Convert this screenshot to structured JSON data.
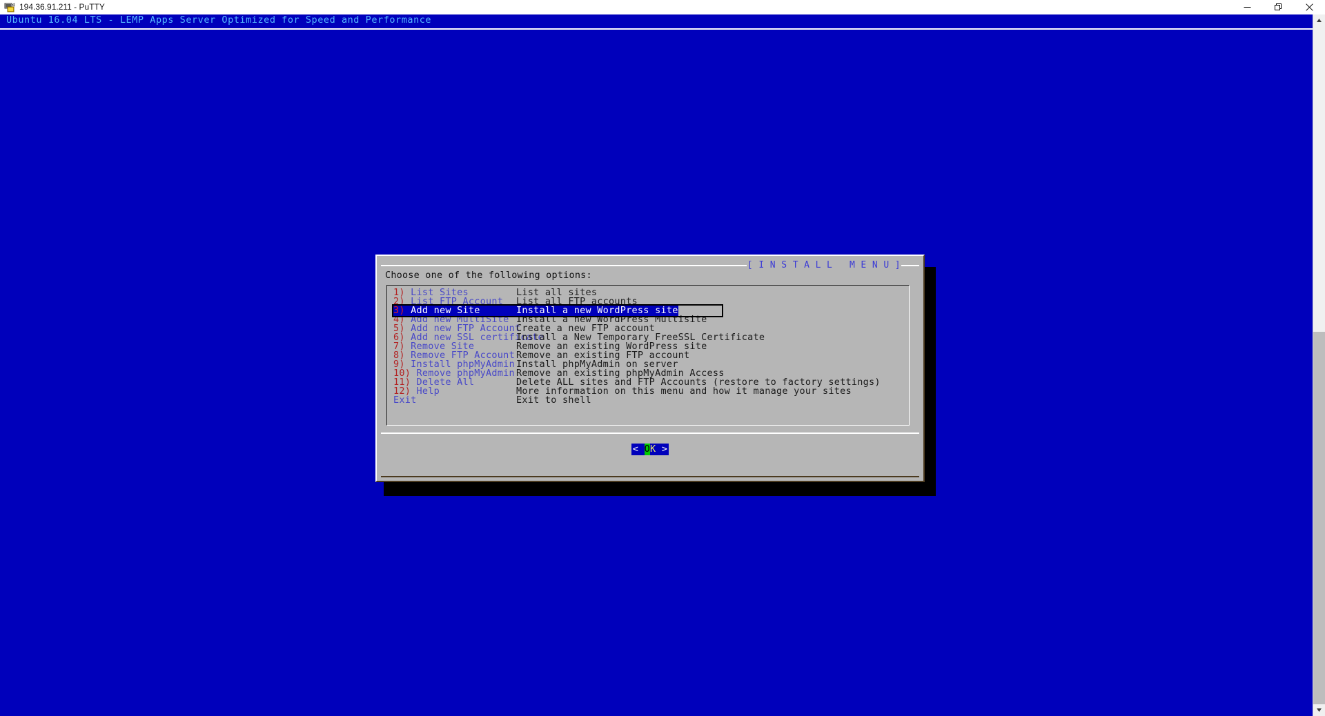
{
  "window": {
    "title": "194.36.91.211 - PuTTY",
    "icon": "putty-icon",
    "controls": {
      "minimize_label": "Minimize",
      "maximize_label": "Maximize",
      "close_label": "Close"
    }
  },
  "terminal": {
    "banner": "Ubuntu 16.04 LTS - LEMP Apps Server Optimized for Speed and Performance",
    "background_color": "#0000bb",
    "banner_color": "#54b8ff"
  },
  "scrollbar": {
    "up_arrow": "⌃",
    "down_arrow": "⌄"
  },
  "dialog": {
    "title": "[ I N S T A L L   M E N U ]",
    "prompt": "Choose one of the following options:",
    "background_color": "#b6b6b6",
    "selected_index": 2,
    "items": [
      {
        "num": "1)",
        "name": "List Sites",
        "desc": "List all sites"
      },
      {
        "num": "2)",
        "name": "List FTP Account",
        "desc": "List all FTP accounts"
      },
      {
        "num": "3)",
        "name": "Add new Site",
        "desc": "Install a new WordPress site"
      },
      {
        "num": "4)",
        "name": "Add new MultiSite",
        "desc": "Install a new WordPress Multisite"
      },
      {
        "num": "5)",
        "name": "Add new FTP Account",
        "desc": "Create a new FTP account"
      },
      {
        "num": "6)",
        "name": "Add new SSL certificate",
        "desc": "Install a New Temporary FreeSSL Certificate"
      },
      {
        "num": "7)",
        "name": "Remove Site",
        "desc": "Remove an existing WordPress site"
      },
      {
        "num": "8)",
        "name": "Remove FTP Account",
        "desc": "Remove an existing FTP account"
      },
      {
        "num": "9)",
        "name": "Install phpMyAdmin",
        "desc": "Install phpMyAdmin on server"
      },
      {
        "num": "10)",
        "name": "Remove phpMyAdmin",
        "desc": "Remove an existing phpMyAdmin Access"
      },
      {
        "num": "11)",
        "name": "Delete All",
        "desc": "Delete ALL sites and FTP Accounts (restore to factory settings)"
      },
      {
        "num": "12)",
        "name": "Help",
        "desc": "More information on this menu and how it manage your sites"
      },
      {
        "num": "",
        "name": "Exit",
        "desc": "Exit to shell"
      }
    ],
    "ok_button": {
      "left_bracket": "<",
      "hotkey": "O",
      "rest": "K",
      "right_bracket": ">",
      "full_label": "< OK >"
    }
  }
}
